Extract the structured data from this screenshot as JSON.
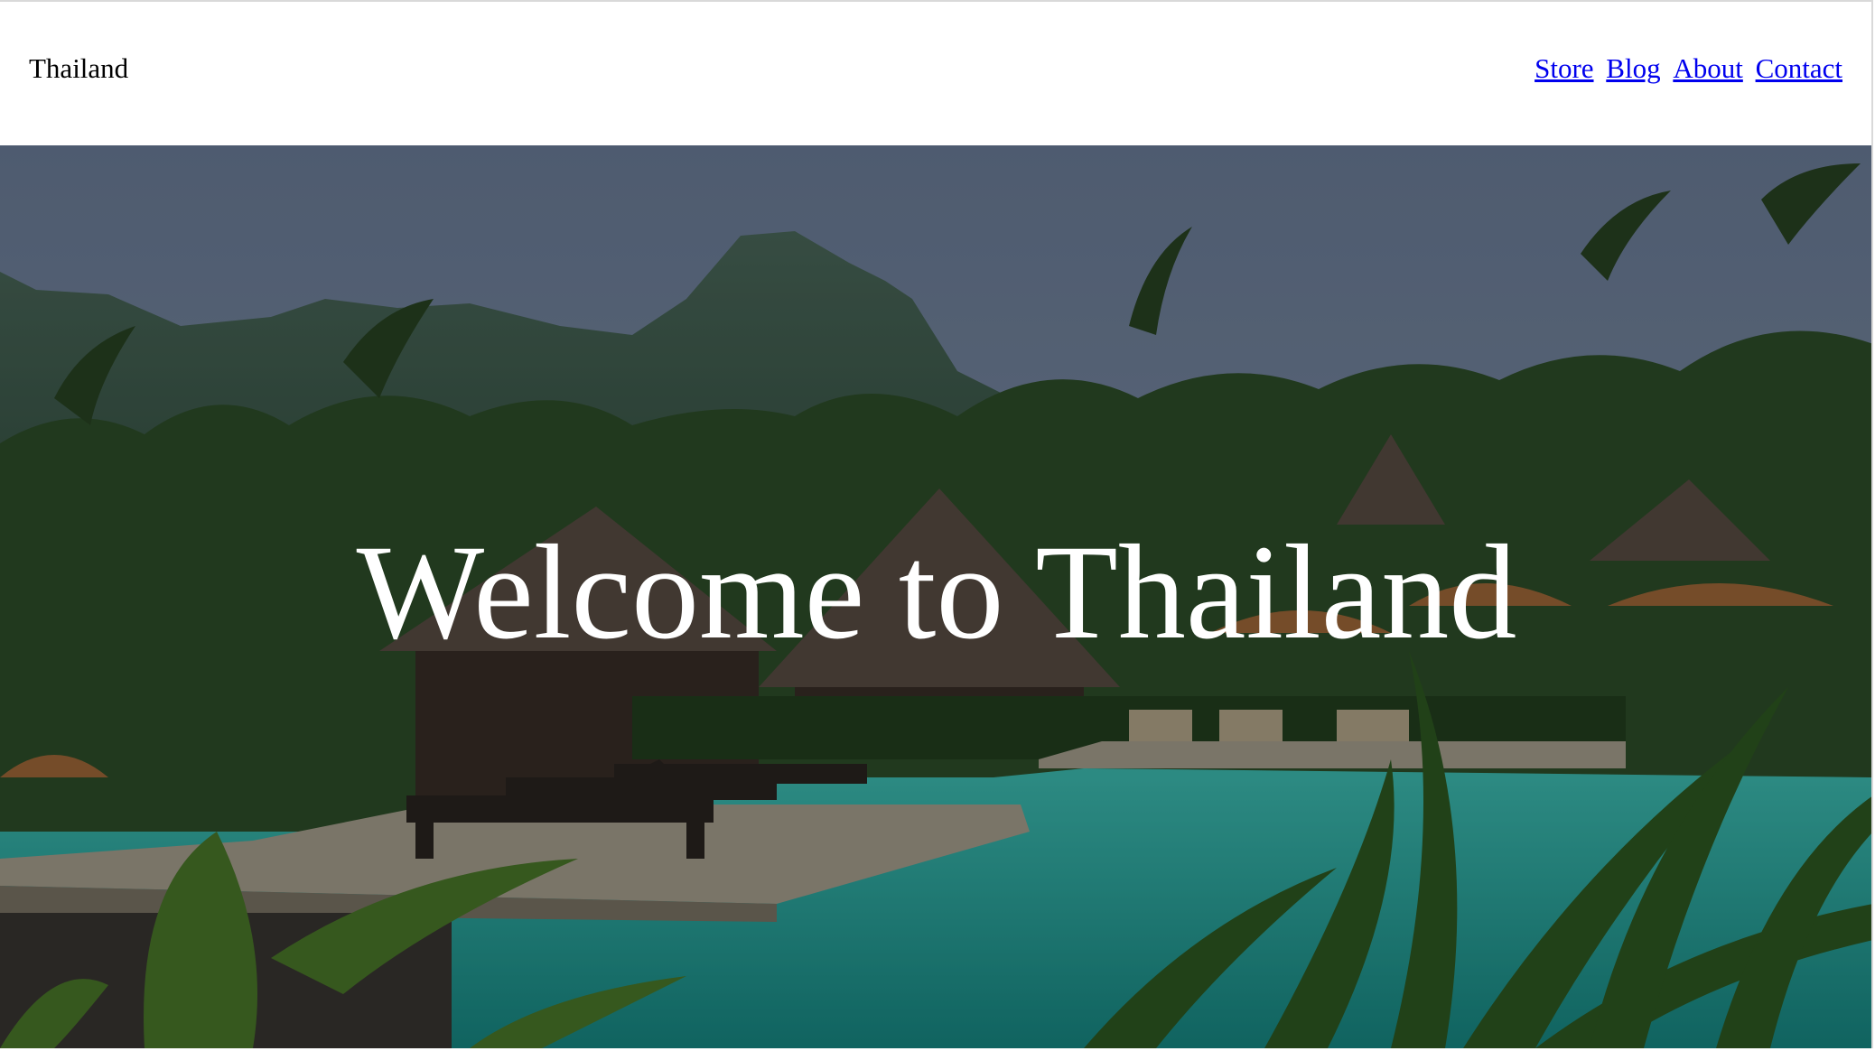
{
  "header": {
    "site_title": "Thailand",
    "nav": [
      {
        "label": "Store"
      },
      {
        "label": "Blog"
      },
      {
        "label": "About"
      },
      {
        "label": "Contact"
      }
    ]
  },
  "hero": {
    "title": "Welcome to Thailand"
  },
  "colors": {
    "link": "#0000ee",
    "text": "#000000",
    "hero_text": "#ffffff",
    "pool_water": "#2aa39a",
    "overlay": "#000000"
  }
}
